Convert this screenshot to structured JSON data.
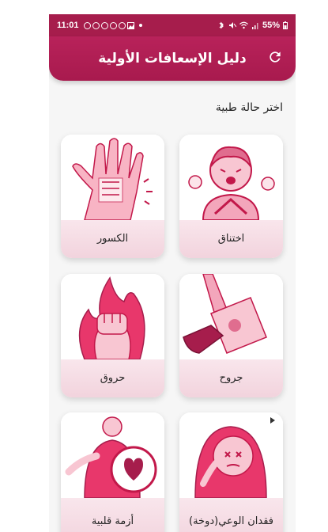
{
  "status_bar": {
    "time": "11:01",
    "battery": "55%"
  },
  "header": {
    "title": "دليل الإسعافات الأولية"
  },
  "section": {
    "title": "اختر حالة طبية"
  },
  "cards": [
    {
      "label": "اختناق"
    },
    {
      "label": "الكسور"
    },
    {
      "label": "جروح"
    },
    {
      "label": "حروق"
    },
    {
      "label": "فقدان الوعي(دوخة)"
    },
    {
      "label": "أزمة قلبية"
    }
  ],
  "colors": {
    "primary": "#a61d4c",
    "accent_pink": "#e8a0b4",
    "dark_red": "#c2184a",
    "label_bg": "#f4d8e1"
  }
}
